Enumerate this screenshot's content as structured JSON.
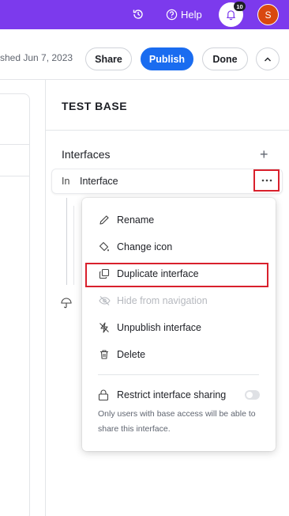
{
  "topbar": {
    "help_label": "Help",
    "notification_count": "10",
    "avatar_initial": "S",
    "accent_color": "#7c3aed"
  },
  "header": {
    "published_text": "shed Jun 7, 2023",
    "share_label": "Share",
    "publish_label": "Publish",
    "done_label": "Done"
  },
  "panel": {
    "base_title": "TEST BASE",
    "section_title": "Interfaces",
    "interface": {
      "abbr": "In",
      "name": "Interface"
    }
  },
  "menu": {
    "items": [
      {
        "label": "Rename",
        "icon": "pencil-icon",
        "disabled": false
      },
      {
        "label": "Change icon",
        "icon": "paint-bucket-icon",
        "disabled": false
      },
      {
        "label": "Duplicate interface",
        "icon": "duplicate-icon",
        "disabled": false
      },
      {
        "label": "Hide from navigation",
        "icon": "eye-slash-icon",
        "disabled": true
      },
      {
        "label": "Unpublish interface",
        "icon": "lightning-slash-icon",
        "disabled": false
      },
      {
        "label": "Delete",
        "icon": "trash-icon",
        "disabled": false
      }
    ],
    "restrict_label": "Restrict interface sharing",
    "restrict_enabled": false,
    "restrict_help": "Only users with base access will be able to share this interface."
  }
}
